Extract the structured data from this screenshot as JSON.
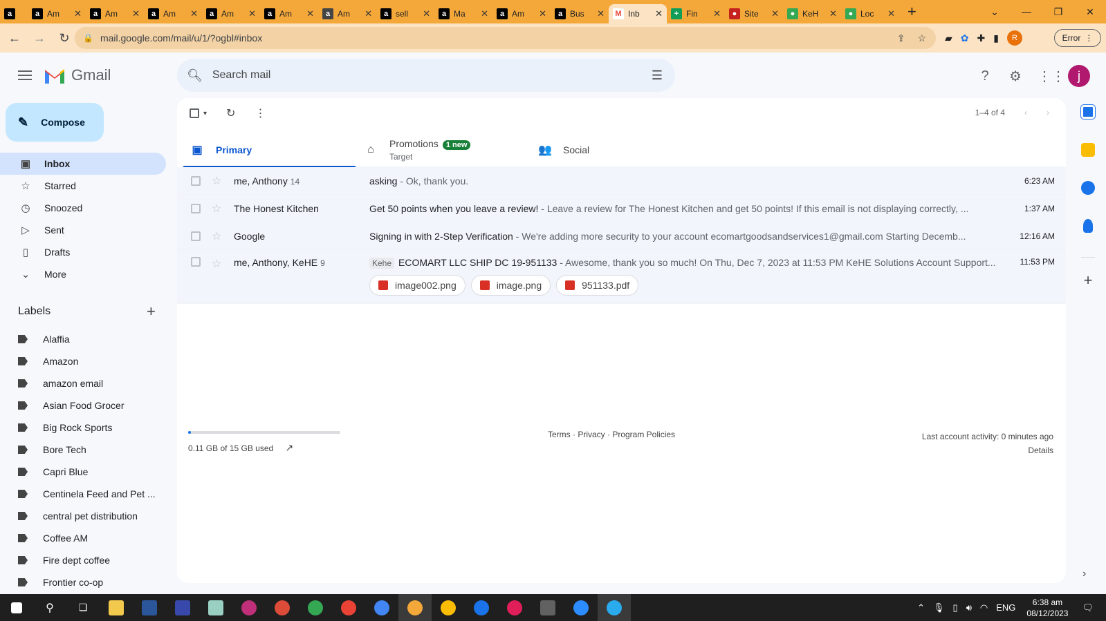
{
  "browser": {
    "tabs": [
      {
        "title": "",
        "favicon": "amazon-icon",
        "color": "#000000",
        "glyph": "a"
      },
      {
        "title": "Am",
        "favicon": "amazon-icon",
        "color": "#000000",
        "glyph": "a"
      },
      {
        "title": "Am",
        "favicon": "amazon-icon",
        "color": "#000000",
        "glyph": "a"
      },
      {
        "title": "Am",
        "favicon": "amazon-icon",
        "color": "#000000",
        "glyph": "a"
      },
      {
        "title": "Am",
        "favicon": "amazon-icon",
        "color": "#000000",
        "glyph": "a"
      },
      {
        "title": "Am",
        "favicon": "amazon-icon",
        "color": "#000000",
        "glyph": "a"
      },
      {
        "title": "Am",
        "favicon": "amazon-round-icon",
        "color": "#444444",
        "glyph": "a"
      },
      {
        "title": "sell",
        "favicon": "amazon-icon",
        "color": "#000000",
        "glyph": "a"
      },
      {
        "title": "Ma",
        "favicon": "amazon-icon",
        "color": "#000000",
        "glyph": "a"
      },
      {
        "title": "Am",
        "favicon": "amazon-icon",
        "color": "#000000",
        "glyph": "a"
      },
      {
        "title": "Bus",
        "favicon": "amazon-icon",
        "color": "#000000",
        "glyph": "a"
      },
      {
        "title": "Inb",
        "favicon": "gmail-icon",
        "color": "#ffffff",
        "glyph": "M",
        "active": true
      },
      {
        "title": "Fin",
        "favicon": "sheets-icon",
        "color": "#0f9d58",
        "glyph": "+"
      },
      {
        "title": "Site",
        "favicon": "site-icon",
        "color": "#c5221f",
        "glyph": "●"
      },
      {
        "title": "KeH",
        "favicon": "kehe-icon",
        "color": "#34a853",
        "glyph": "●"
      },
      {
        "title": "Loc",
        "favicon": "kehe-icon",
        "color": "#34a853",
        "glyph": "●"
      }
    ],
    "url": "mail.google.com/mail/u/1/?ogbl#inbox",
    "profile_initial": "R",
    "error_label": "Error"
  },
  "gmail": {
    "brand": "Gmail",
    "search_placeholder": "Search mail",
    "account_initial": "j",
    "compose_label": "Compose",
    "nav": [
      {
        "label": "Inbox",
        "icon": "inbox-icon",
        "glyph": "▣",
        "active": true
      },
      {
        "label": "Starred",
        "icon": "star-icon",
        "glyph": "☆"
      },
      {
        "label": "Snoozed",
        "icon": "clock-icon",
        "glyph": "◷"
      },
      {
        "label": "Sent",
        "icon": "send-icon",
        "glyph": "▷"
      },
      {
        "label": "Drafts",
        "icon": "draft-icon",
        "glyph": "▯"
      },
      {
        "label": "More",
        "icon": "chevron-down-icon",
        "glyph": "⌄"
      }
    ],
    "labels_heading": "Labels",
    "labels": [
      "Alaffia",
      "Amazon",
      "amazon email",
      "Asian Food Grocer",
      "Big Rock Sports",
      "Bore Tech",
      "Capri Blue",
      "Centinela Feed and Pet ...",
      "central pet distribution",
      "Coffee AM",
      "Fire dept coffee",
      "Frontier co-op"
    ],
    "pager": "1–4 of 4",
    "tabs": [
      {
        "label": "Primary",
        "icon": "inbox-icon",
        "glyph": "▣",
        "active": true,
        "sub": "",
        "badge": ""
      },
      {
        "label": "Promotions",
        "icon": "tag-icon",
        "glyph": "⌂",
        "sub": "Target",
        "badge": "1 new"
      },
      {
        "label": "Social",
        "icon": "people-icon",
        "glyph": "👥",
        "sub": "",
        "badge": ""
      }
    ],
    "emails": [
      {
        "sender": "me, Anthony",
        "count": "14",
        "tag": "",
        "subject": "asking",
        "snippet": " - Ok, thank you.",
        "time": "6:23 AM"
      },
      {
        "sender": "The Honest Kitchen",
        "count": "",
        "tag": "",
        "subject": "Get 50 points when you leave a review!",
        "snippet": " - Leave a review for The Honest Kitchen and get 50 points! If this email is not displaying correctly, ...",
        "time": "1:37 AM"
      },
      {
        "sender": "Google",
        "count": "",
        "tag": "",
        "subject": "Signing in with 2-Step Verification",
        "snippet": " - We're adding more security to your account ecomartgoodsandservices1@gmail.com Starting Decemb...",
        "time": "12:16 AM"
      },
      {
        "sender": "me, Anthony, KeHE",
        "count": "9",
        "tag": "Kehe",
        "subject": "ECOMART LLC SHIP DC 19-951133",
        "snippet": " - Awesome, thank you so much! On Thu, Dec 7, 2023 at 11:53 PM KeHE Solutions Account Support...",
        "time": "11:53 PM",
        "attachments": [
          "image002.png",
          "image.png",
          "951133.pdf"
        ]
      }
    ],
    "storage": "0.11 GB of 15 GB used",
    "storage_used_fraction": 0.0073,
    "footer_links": "Terms · Privacy · Program Policies",
    "last_activity": "Last account activity: 0 minutes ago",
    "details": "Details"
  },
  "taskbar": {
    "lang": "ENG",
    "time": "6:38 am",
    "date": "08/12/2023"
  }
}
